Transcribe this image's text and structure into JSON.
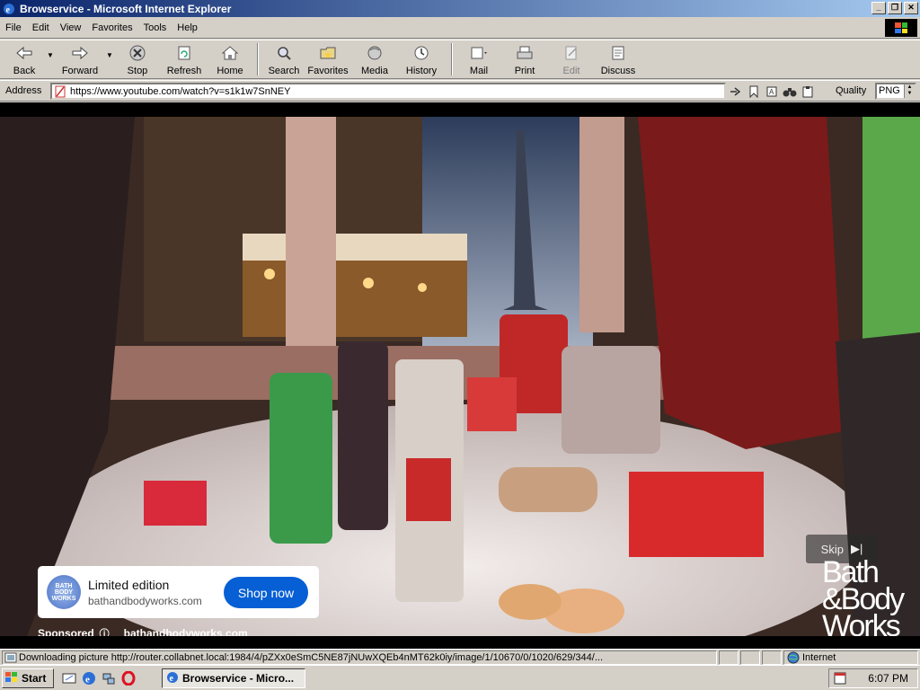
{
  "window": {
    "title": "Browservice - Microsoft Internet Explorer"
  },
  "menu": {
    "items": [
      "File",
      "Edit",
      "View",
      "Favorites",
      "Tools",
      "Help"
    ]
  },
  "toolbar": {
    "back": "Back",
    "forward": "Forward",
    "stop": "Stop",
    "refresh": "Refresh",
    "home": "Home",
    "search": "Search",
    "favorites": "Favorites",
    "media": "Media",
    "history": "History",
    "mail": "Mail",
    "print": "Print",
    "edit": "Edit",
    "discuss": "Discuss"
  },
  "address": {
    "label": "Address",
    "url": "https://www.youtube.com/watch?v=s1k1w7SnNEY",
    "quality_label": "Quality",
    "quality_value": "PNG"
  },
  "ad": {
    "title": "Limited edition",
    "domain": "bathandbodyworks.com",
    "cta": "Shop now",
    "sponsored": "Sponsored",
    "sponsored_domain": "bathandbodyworks.com",
    "skip": "Skip",
    "brand_line1": "Bath",
    "brand_line2": "&Body",
    "brand_line3": "Works",
    "logo_text": "BATH BODY WORKS"
  },
  "status": {
    "text": "Downloading picture http://router.collabnet.local:1984/4/pZXx0eSmC5NE87jNUwXQEb4nMT62k0iy/image/1/10670/0/1020/629/344/...",
    "zone": "Internet"
  },
  "taskbar": {
    "start": "Start",
    "task": "Browservice - Micro...",
    "clock": "6:07 PM"
  },
  "colors": {
    "titlebar": "#0a246a",
    "chrome": "#d4d0c8",
    "shop_button": "#065fd4"
  }
}
